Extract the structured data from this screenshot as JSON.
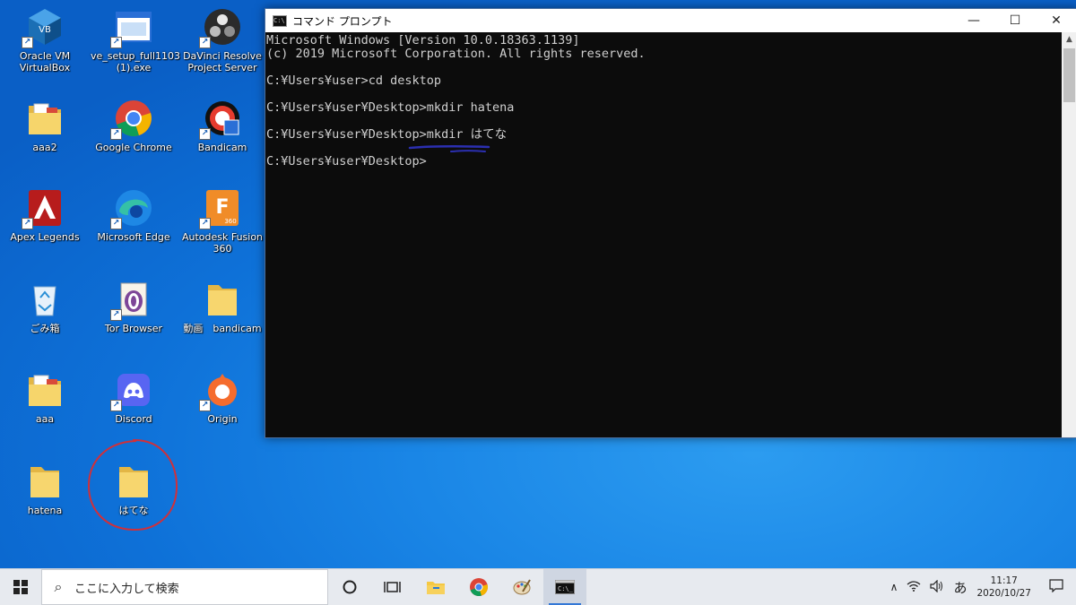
{
  "desktop": {
    "icons": [
      {
        "label": "Oracle VM\nVirtualBox",
        "kind": "virtualbox"
      },
      {
        "label": "ve_setup_full1103\n(1).exe",
        "kind": "exe"
      },
      {
        "label": "DaVinci Resolve\nProject Server",
        "kind": "davinci"
      },
      {
        "label": "aaa2",
        "kind": "folder-docs"
      },
      {
        "label": "Google Chrome",
        "kind": "chrome"
      },
      {
        "label": "Bandicam",
        "kind": "bandicam"
      },
      {
        "label": "Apex Legends",
        "kind": "apex"
      },
      {
        "label": "Microsoft Edge",
        "kind": "edge"
      },
      {
        "label": "Autodesk Fusion\n360",
        "kind": "fusion"
      },
      {
        "label": "ごみ箱",
        "kind": "recycle"
      },
      {
        "label": "Tor Browser",
        "kind": "tor"
      },
      {
        "label": "動画　bandicam",
        "kind": "folder"
      },
      {
        "label": "aaa",
        "kind": "folder-docs"
      },
      {
        "label": "Discord",
        "kind": "discord"
      },
      {
        "label": "Origin",
        "kind": "origin"
      },
      {
        "label": "hatena",
        "kind": "folder"
      },
      {
        "label": "はてな",
        "kind": "folder"
      }
    ]
  },
  "cmd_window": {
    "title": "コマンド プロンプト",
    "buttons": {
      "minimize": "—",
      "maximize": "☐",
      "close": "✕"
    },
    "lines": [
      "Microsoft Windows [Version 10.0.18363.1139]",
      "(c) 2019 Microsoft Corporation. All rights reserved.",
      "",
      "C:¥Users¥user>cd desktop",
      "",
      "C:¥Users¥user¥Desktop>mkdir hatena",
      "",
      "C:¥Users¥user¥Desktop>mkdir はてな",
      "",
      "C:¥Users¥user¥Desktop>"
    ]
  },
  "taskbar": {
    "search_placeholder": "ここに入力して検索",
    "tray_ime": "あ",
    "time": "11:17",
    "date": "2020/10/27"
  },
  "colors": {
    "annotation_underline": "#2b2fb0",
    "annotation_circle": "#d0303a",
    "taskbar_accent": "#3478d6"
  }
}
